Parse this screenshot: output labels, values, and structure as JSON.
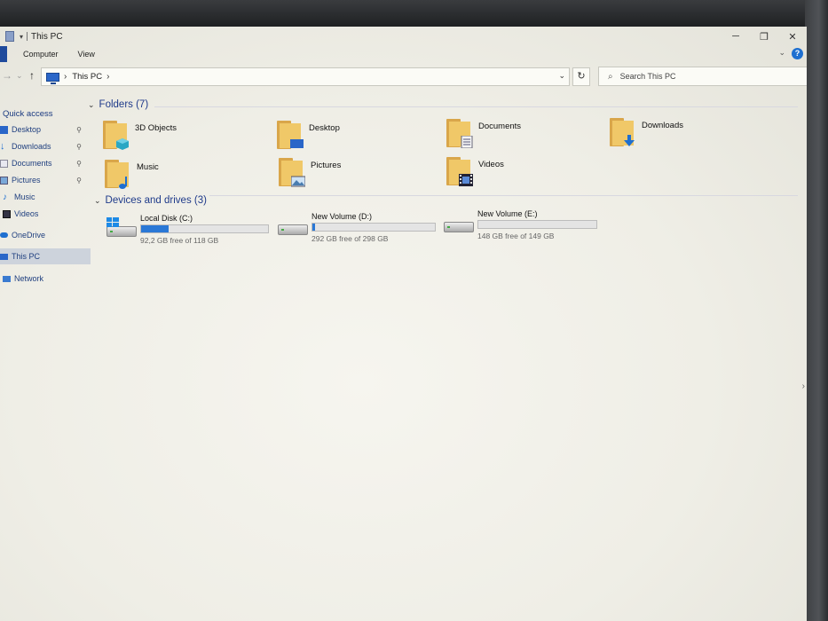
{
  "window": {
    "title": "This PC"
  },
  "window_controls": {
    "minimize": "─",
    "maximize": "❐",
    "close": "✕"
  },
  "ribbon": {
    "tabs": [
      "Computer",
      "View"
    ],
    "collapse": "⌄",
    "help": "?"
  },
  "nav": {
    "back": "←",
    "forward": "→",
    "recent": "⌄",
    "up": "↑"
  },
  "address": {
    "separator": "›",
    "location": "This PC",
    "trail": "›",
    "dropdown": "⌄",
    "refresh": "↻"
  },
  "search": {
    "placeholder": "Search This PC"
  },
  "sidebar": {
    "quick_access": "Quick access",
    "pinned": [
      {
        "label": "Desktop",
        "icon": "desktop-icon",
        "pin": "📌"
      },
      {
        "label": "Downloads",
        "icon": "downloads-icon",
        "pin": "📌"
      },
      {
        "label": "Documents",
        "icon": "documents-icon",
        "pin": "📌"
      },
      {
        "label": "Pictures",
        "icon": "pictures-icon",
        "pin": "📌"
      }
    ],
    "items": [
      {
        "label": "Music",
        "icon": "music-icon"
      },
      {
        "label": "Videos",
        "icon": "videos-icon"
      },
      {
        "label": "OneDrive",
        "icon": "onedrive-icon"
      },
      {
        "label": "This PC",
        "icon": "this-pc-icon",
        "selected": true
      },
      {
        "label": "Network",
        "icon": "network-icon"
      }
    ]
  },
  "folders_section": {
    "title": "Folders (7)",
    "chevron": "⌄",
    "items": [
      {
        "label": "3D Objects",
        "icon": "3d-objects-folder-icon"
      },
      {
        "label": "Desktop",
        "icon": "desktop-folder-icon"
      },
      {
        "label": "Documents",
        "icon": "documents-folder-icon"
      },
      {
        "label": "Downloads",
        "icon": "downloads-folder-icon"
      },
      {
        "label": "Music",
        "icon": "music-folder-icon"
      },
      {
        "label": "Pictures",
        "icon": "pictures-folder-icon"
      },
      {
        "label": "Videos",
        "icon": "videos-folder-icon"
      }
    ]
  },
  "drives_section": {
    "title": "Devices and drives (3)",
    "chevron": "⌄",
    "items": [
      {
        "name": "Local Disk (C:)",
        "free": "92,2 GB free of 118 GB",
        "used_fraction": 0.22,
        "system": true
      },
      {
        "name": "New Volume (D:)",
        "free": "292 GB free of 298 GB",
        "used_fraction": 0.02
      },
      {
        "name": "New Volume (E:)",
        "free": "148 GB free of 149 GB",
        "used_fraction": 0.0
      }
    ]
  },
  "colors": {
    "accent": "#2a78d6",
    "folder": "#f0c868",
    "link": "#1e3a8a"
  }
}
